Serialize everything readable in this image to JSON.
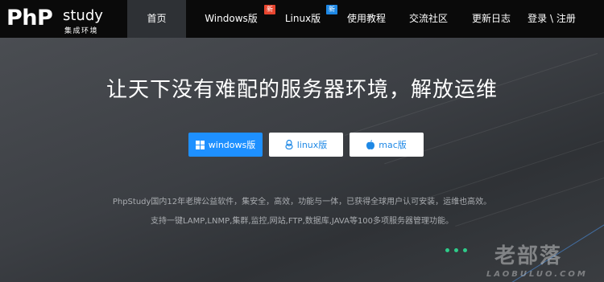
{
  "logo": {
    "php": "PhP",
    "study": "study",
    "sub": "集成环境"
  },
  "nav": [
    {
      "label": "首页",
      "active": true
    },
    {
      "label": "Windows版",
      "badge": "新",
      "badge_color": "#e8452f"
    },
    {
      "label": "Linux版",
      "badge": "新",
      "badge_color": "#1e88e5"
    },
    {
      "label": "使用教程"
    },
    {
      "label": "交流社区"
    },
    {
      "label": "更新日志"
    },
    {
      "label": "登录 \\ 注册"
    }
  ],
  "hero": {
    "headline": "让天下没有难配的服务器环境，解放运维",
    "buttons": [
      {
        "label": "windows版",
        "icon": "windows-icon"
      },
      {
        "label": "linux版",
        "icon": "linux-icon"
      },
      {
        "label": "mac版",
        "icon": "apple-icon"
      }
    ],
    "desc1": "PhpStudy国内12年老牌公益软件，集安全，高效，功能与一体，已获得全球用户认可安装，运维也高效。",
    "desc2": "支持一键LAMP,LNMP,集群,监控,网站,FTP,数据库,JAVA等100多项服务器管理功能。"
  },
  "watermark": {
    "cn": "老部落",
    "en": "LAOBULUO.COM"
  },
  "colors": {
    "primary": "#1e90ff",
    "nav_bg": "#0a0a0a",
    "active_bg": "#2e3135"
  }
}
